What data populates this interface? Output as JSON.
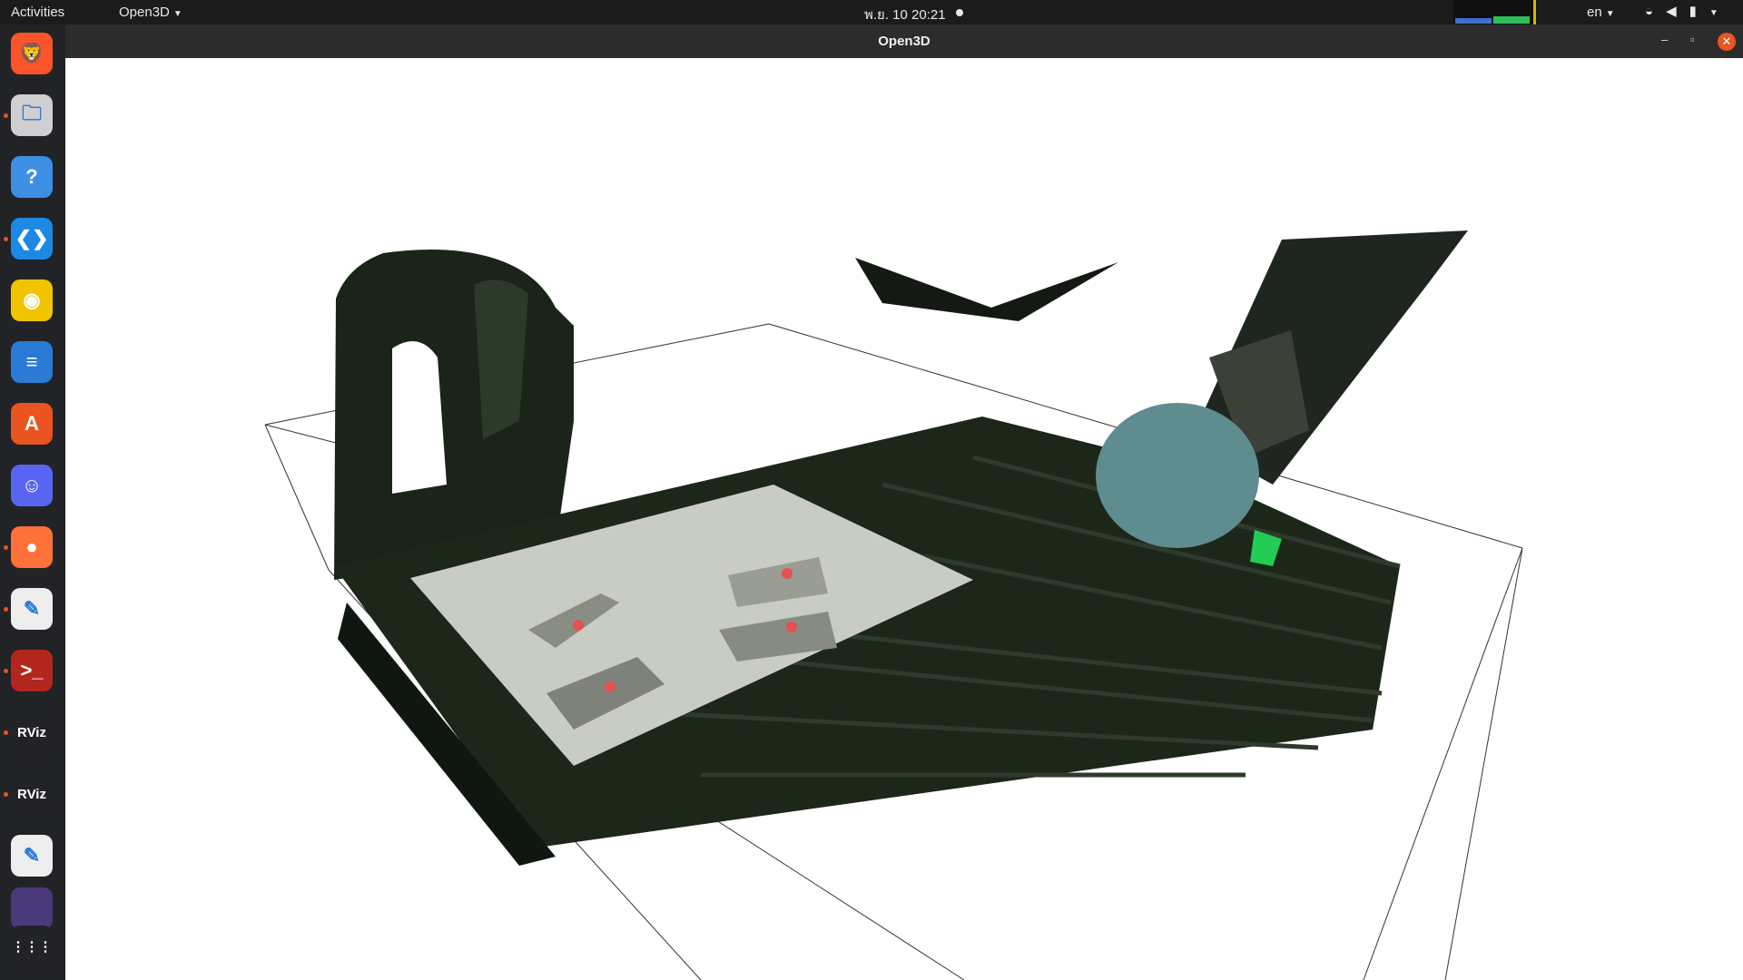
{
  "topbar": {
    "activities": "Activities",
    "app_menu": "Open3D",
    "clock": "พ.ย. 10  20:21",
    "lang": "en"
  },
  "window": {
    "title": "Open3D",
    "minimize": "–",
    "maximize": "▫",
    "close": "✕"
  },
  "dock": {
    "items": [
      {
        "name": "brave-browser-icon",
        "glyph": "🦁",
        "color": "#fb542b"
      },
      {
        "name": "files-icon",
        "glyph": "🗀",
        "color": "#cfcfcf"
      },
      {
        "name": "help-icon",
        "glyph": "?",
        "color": "#3d8fe3"
      },
      {
        "name": "vscode-icon",
        "glyph": "❮❯",
        "color": "#1e88e5"
      },
      {
        "name": "rhythmbox-icon",
        "glyph": "◉",
        "color": "#f2c400"
      },
      {
        "name": "writer-icon",
        "glyph": "≡",
        "color": "#2a7ad6"
      },
      {
        "name": "app-store-icon",
        "glyph": "A",
        "color": "#e95420"
      },
      {
        "name": "discord-icon",
        "glyph": "☺",
        "color": "#5865f2"
      },
      {
        "name": "firefox-icon",
        "glyph": "●",
        "color": "#ff7139"
      },
      {
        "name": "text-editor-icon",
        "glyph": "✎",
        "color": "#eeeeee"
      },
      {
        "name": "terminal-icon",
        "glyph": ">_",
        "color": "#b3261e"
      },
      {
        "name": "rviz-icon",
        "glyph": "RViz",
        "color": "#222327"
      },
      {
        "name": "rviz-icon-2",
        "glyph": "RViz",
        "color": "#222327"
      },
      {
        "name": "text-editor-icon-2",
        "glyph": "✎",
        "color": "#eeeeee"
      },
      {
        "name": "purple-app-icon",
        "glyph": "",
        "color": "#4b3a7a"
      },
      {
        "name": "show-apps-icon",
        "glyph": "⋮⋮⋮",
        "color": "#222327"
      }
    ]
  },
  "colors": {
    "accent": "#e95420",
    "topbar": "#1b1b1b",
    "dock": "#222327",
    "titlebar": "#2c2c2c",
    "viewport": "#ffffff"
  }
}
